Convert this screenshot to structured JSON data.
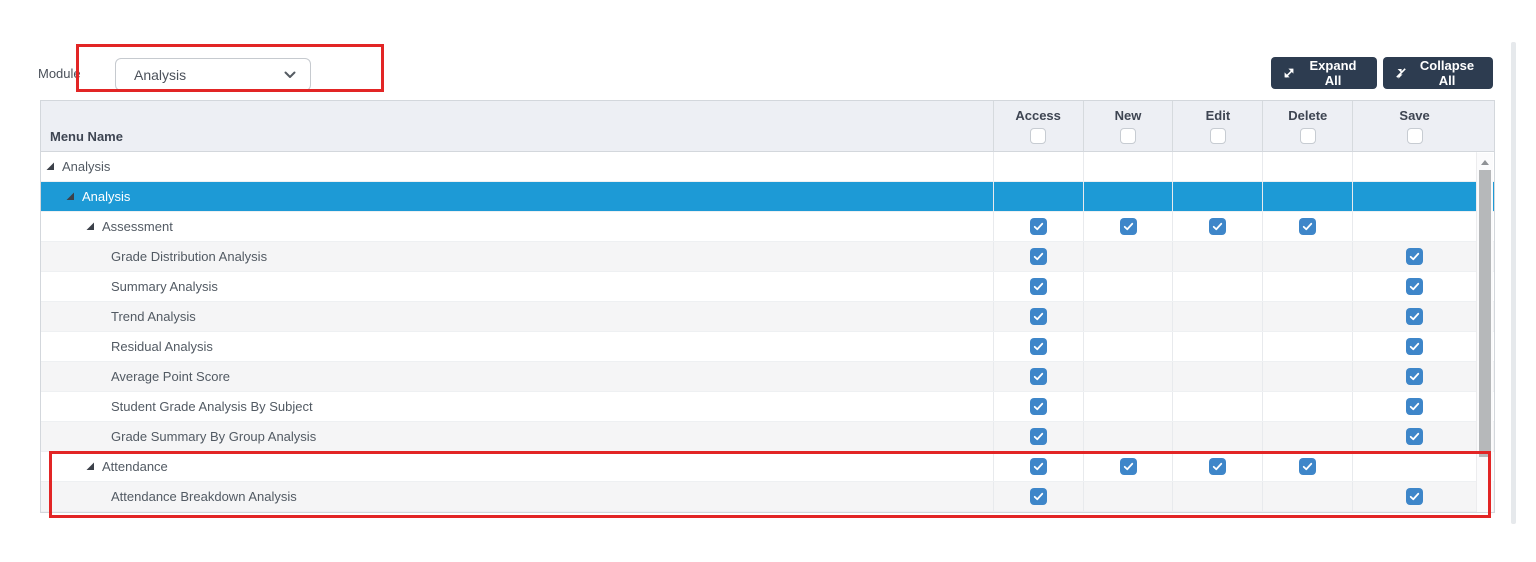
{
  "module": {
    "label": "Module",
    "selected_value": "Analysis"
  },
  "toolbar": {
    "expand_all_label": "Expand All",
    "collapse_all_label": "Collapse All"
  },
  "table": {
    "menu_name_header": "Menu Name",
    "permission_columns": [
      "Access",
      "New",
      "Edit",
      "Delete",
      "Save"
    ],
    "rows": [
      {
        "label": "Analysis",
        "level": 0,
        "has_children": true,
        "selected": false,
        "checks": [
          false,
          false,
          false,
          false,
          false
        ]
      },
      {
        "label": "Analysis",
        "level": 1,
        "has_children": true,
        "selected": true,
        "checks": [
          false,
          false,
          false,
          false,
          false
        ]
      },
      {
        "label": "Assessment",
        "level": 2,
        "has_children": true,
        "selected": false,
        "checks": [
          true,
          true,
          true,
          true,
          false
        ]
      },
      {
        "label": "Grade Distribution Analysis",
        "level": 3,
        "has_children": false,
        "selected": false,
        "checks": [
          true,
          false,
          false,
          false,
          true
        ]
      },
      {
        "label": "Summary Analysis",
        "level": 3,
        "has_children": false,
        "selected": false,
        "checks": [
          true,
          false,
          false,
          false,
          true
        ]
      },
      {
        "label": "Trend Analysis",
        "level": 3,
        "has_children": false,
        "selected": false,
        "checks": [
          true,
          false,
          false,
          false,
          true
        ]
      },
      {
        "label": "Residual Analysis",
        "level": 3,
        "has_children": false,
        "selected": false,
        "checks": [
          true,
          false,
          false,
          false,
          true
        ]
      },
      {
        "label": "Average Point Score",
        "level": 3,
        "has_children": false,
        "selected": false,
        "checks": [
          true,
          false,
          false,
          false,
          true
        ]
      },
      {
        "label": "Student Grade Analysis By Subject",
        "level": 3,
        "has_children": false,
        "selected": false,
        "checks": [
          true,
          false,
          false,
          false,
          true
        ]
      },
      {
        "label": "Grade Summary By Group Analysis",
        "level": 3,
        "has_children": false,
        "selected": false,
        "checks": [
          true,
          false,
          false,
          false,
          true
        ]
      },
      {
        "label": "Attendance",
        "level": 2,
        "has_children": true,
        "selected": false,
        "checks": [
          true,
          true,
          true,
          true,
          false
        ]
      },
      {
        "label": "Attendance Breakdown Analysis",
        "level": 3,
        "has_children": false,
        "selected": false,
        "checks": [
          true,
          false,
          false,
          false,
          true
        ]
      }
    ]
  },
  "icons": {
    "select_chevron": "chevron-down-icon",
    "expand": "expand-arrows-icon",
    "collapse": "collapse-arrows-icon",
    "tree_expanded": "triangle-expanded-icon",
    "scroll_up": "scroll-up-arrow-icon",
    "checkbox_check": "check-icon"
  },
  "colors": {
    "selected_row": "#1d9ad6",
    "checkbox_checked": "#3e86c9",
    "button_bg": "#2d3c50",
    "annotation": "#e22525",
    "header_bg": "#edeff4"
  }
}
